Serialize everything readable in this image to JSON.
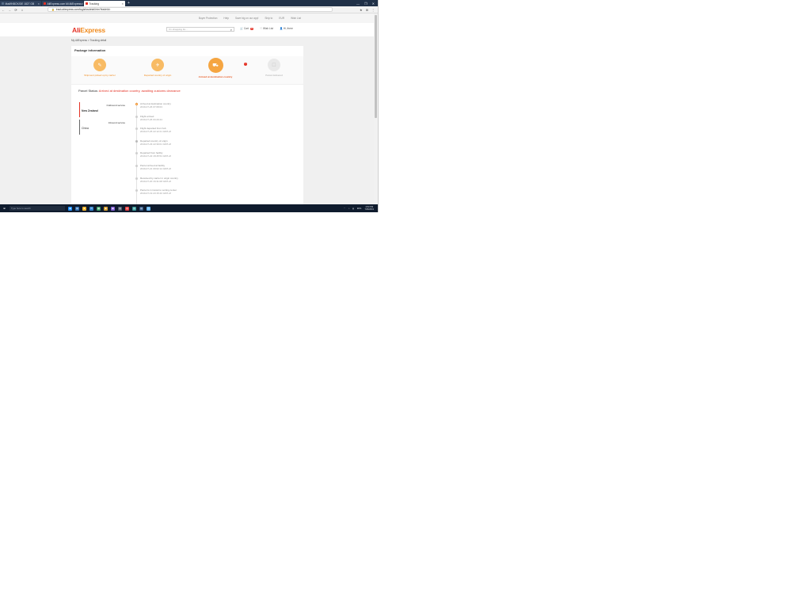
{
  "browser": {
    "tabs": [
      {
        "label": "Mail/INBOX/DE 1827 GB",
        "favicon_color": "#5a6f8a",
        "active": false
      },
      {
        "label": "AliExpress.com Mi AliExpress",
        "favicon_color": "#e43225",
        "active": false
      },
      {
        "label": "Tracking",
        "favicon_color": "#e43225",
        "active": true
      }
    ],
    "new_tab": "+",
    "window_controls": [
      "—",
      "❐",
      "✕"
    ],
    "nav": {
      "back": "←",
      "forward": "→",
      "reload": "⟳",
      "home": "⌂"
    },
    "url": "track.aliexpress.com/logisticsdetail.htm?tradeId=",
    "addr_icons": [
      "★",
      "⊞",
      "⋮"
    ]
  },
  "site_top": {
    "items": [
      "Buyer Protection",
      "Help",
      "Save big on our app!",
      "Ship to",
      "EUR",
      "Wish List"
    ]
  },
  "header": {
    "logo_a": "Ali",
    "logo_b": "Express",
    "search_placeholder": "I'm shopping for...",
    "cart_label": "Cart",
    "cart_count": "0",
    "wishlist": "Wish List",
    "account": "Hi, there"
  },
  "breadcrumb": "My AliExpress > Tracking detail",
  "package": {
    "title": "Package information",
    "alert_badge": "!",
    "steps": [
      {
        "label": "Shipment picked up by carrier",
        "icon": "✎",
        "state": "done"
      },
      {
        "label": "Departed country of origin",
        "icon": "✈",
        "state": "done"
      },
      {
        "label": "Arrived at destination country",
        "icon": "⛟",
        "state": "current"
      },
      {
        "label": "Parcel delivered",
        "icon": "☐",
        "state": "pending"
      }
    ]
  },
  "status": {
    "prefix": "Parcel Status:",
    "value": "Arrived at destination country, awaiting customs clearance"
  },
  "services": [
    {
      "top": "Outbound service",
      "main": "New Zealand",
      "active": true
    },
    {
      "top": "Inbound service",
      "main": "China",
      "active": false
    }
  ],
  "events": [
    {
      "title": "Arrived at destination country",
      "time": "2019-07-26 07:08:03"
    },
    {
      "title": "Flight arrived",
      "time": "2019-07-26 04:29:44"
    },
    {
      "title": "Flight departed from hub",
      "time": "2019-07-25 22:12:21 GMT+8"
    },
    {
      "title": "Departed country of origin",
      "time": "2019-07-23 22:39:01 GMT+8"
    },
    {
      "title": "Departed from facility",
      "time": "2019-07-22 18:45:54 GMT+8"
    },
    {
      "title": "Parcel arrived at facility",
      "time": "2019-07-21 09:02:14 GMT+8"
    },
    {
      "title": "Received by carrier in origin country",
      "time": "2019-07-20 16:31:08 GMT+8"
    },
    {
      "title": "Parcel is in transit to sorting center",
      "time": "2019-07-19 23:15:40 GMT+8"
    }
  ],
  "taskbar": {
    "start": "⊞",
    "search_text": "Type here to search",
    "apps": [
      {
        "icon": "◉",
        "color": "#1e90ff"
      },
      {
        "icon": "▤",
        "color": "#2b6cb0"
      },
      {
        "icon": "■",
        "color": "#f0b429"
      },
      {
        "icon": "✉",
        "color": "#3182ce"
      },
      {
        "icon": "▦",
        "color": "#38a169"
      },
      {
        "icon": "◆",
        "color": "#d69e2e"
      },
      {
        "icon": "▣",
        "color": "#805ad5"
      },
      {
        "icon": "▥",
        "color": "#4a5568"
      },
      {
        "icon": "◍",
        "color": "#e53e3e"
      },
      {
        "icon": "▧",
        "color": "#319795"
      },
      {
        "icon": "▨",
        "color": "#2c5282"
      },
      {
        "icon": "◎",
        "color": "#63b3ed"
      }
    ],
    "tray": [
      "⌃",
      "♪",
      "▮",
      "ENG"
    ],
    "time": "4:53 PM",
    "date": "7/26/2019"
  }
}
